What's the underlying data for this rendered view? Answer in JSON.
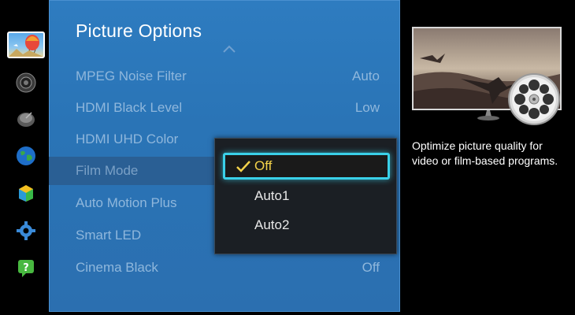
{
  "panel": {
    "title": "Picture Options"
  },
  "menu": [
    {
      "label": "MPEG Noise Filter",
      "value": "Auto"
    },
    {
      "label": "HDMI Black Level",
      "value": "Low"
    },
    {
      "label": "HDMI UHD Color",
      "value": ""
    },
    {
      "label": "Film Mode",
      "value": ""
    },
    {
      "label": "Auto Motion Plus",
      "value": ""
    },
    {
      "label": "Smart LED",
      "value": ""
    },
    {
      "label": "Cinema Black",
      "value": "Off"
    }
  ],
  "dropdown": {
    "options": [
      "Off",
      "Auto1",
      "Auto2"
    ],
    "selected": "Off"
  },
  "description": "Optimize picture quality for video or film-based programs.",
  "rail_icons": [
    "picture-icon",
    "sound-icon",
    "broadcast-icon",
    "network-icon",
    "smart-features-icon",
    "system-icon",
    "support-icon"
  ],
  "colors": {
    "panel_blue": "#2e7cc0",
    "focus_cyan": "#3ad0e8",
    "check_yellow": "#f4d24a"
  }
}
